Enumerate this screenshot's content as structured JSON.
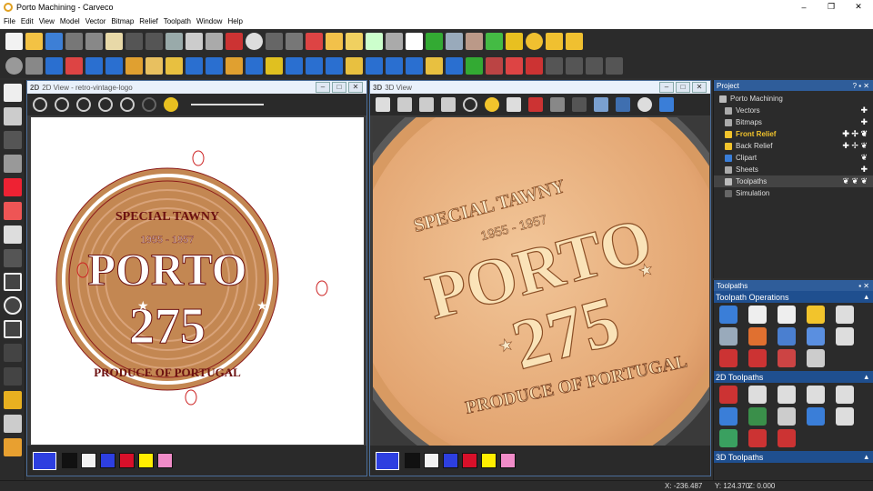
{
  "window": {
    "title": "Porto Machining - Carveco",
    "minimize": "–",
    "maximize": "❐",
    "close": "✕"
  },
  "menu": [
    "File",
    "Edit",
    "View",
    "Model",
    "Vector",
    "Bitmap",
    "Relief",
    "Toolpath",
    "Window",
    "Help"
  ],
  "view2d": {
    "title": "2D View - retro-vintage-logo",
    "tag": "2D"
  },
  "view3d": {
    "title": "3D View",
    "tag": "3D"
  },
  "logo": {
    "top": "SPECIAL TAWNY",
    "years": "1955 - 1957",
    "word": "PORTO",
    "number": "275",
    "bottom2d": "PRODUCE OF PORTUGAL",
    "bottom3d": "PRODUCE OF PORTUGAL"
  },
  "palette_colors": [
    "#111111",
    "#f2f2f2",
    "#2d3fe0",
    "#d8102a",
    "#ffee00",
    "#f08cc8"
  ],
  "project": {
    "header": "Project",
    "items": [
      {
        "label": "Porto Machining",
        "actions": ""
      },
      {
        "label": "Vectors",
        "actions": "✚"
      },
      {
        "label": "Bitmaps",
        "actions": "✚"
      },
      {
        "label": "Front Relief",
        "actions": "✚ ✢ ❦"
      },
      {
        "label": "Back Relief",
        "actions": "✚ ✢ ❦"
      },
      {
        "label": "Clipart",
        "actions": "❦"
      },
      {
        "label": "Sheets",
        "actions": "✚"
      },
      {
        "label": "Toolpaths",
        "actions": "❦ ❦ ❦"
      },
      {
        "label": "Simulation",
        "actions": ""
      }
    ]
  },
  "toolpaths": {
    "header": "Toolpaths",
    "sections": [
      "Toolpath Operations",
      "2D Toolpaths",
      "3D Toolpaths"
    ]
  },
  "status": {
    "x": "X: -236.487",
    "y": "Y: 124.370",
    "z": "Z: 0.000"
  }
}
